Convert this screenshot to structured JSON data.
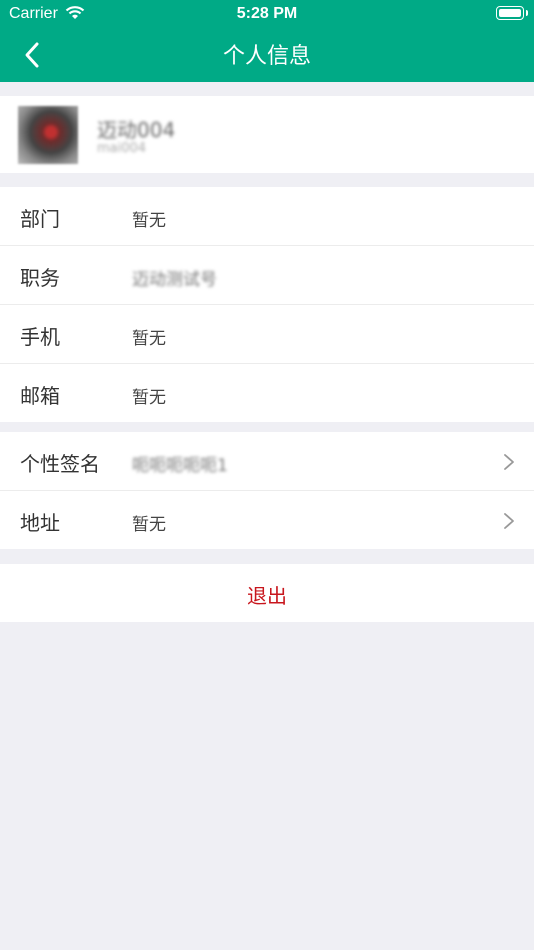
{
  "status_bar": {
    "carrier": "Carrier",
    "time": "5:28 PM"
  },
  "nav": {
    "title": "个人信息"
  },
  "profile": {
    "name": "迈动004",
    "id": "mai004"
  },
  "info": [
    {
      "label": "部门",
      "value": "暂无"
    },
    {
      "label": "职务",
      "value": "迈动测试号"
    },
    {
      "label": "手机",
      "value": "暂无"
    },
    {
      "label": "邮箱",
      "value": "暂无"
    }
  ],
  "extra": [
    {
      "label": "个性签名",
      "value": "呃呃呃呃呃1"
    },
    {
      "label": "地址",
      "value": "暂无"
    }
  ],
  "logout_label": "退出",
  "colors": {
    "header": "#00aa86",
    "logout": "#c8161d",
    "background": "#efeff4"
  }
}
